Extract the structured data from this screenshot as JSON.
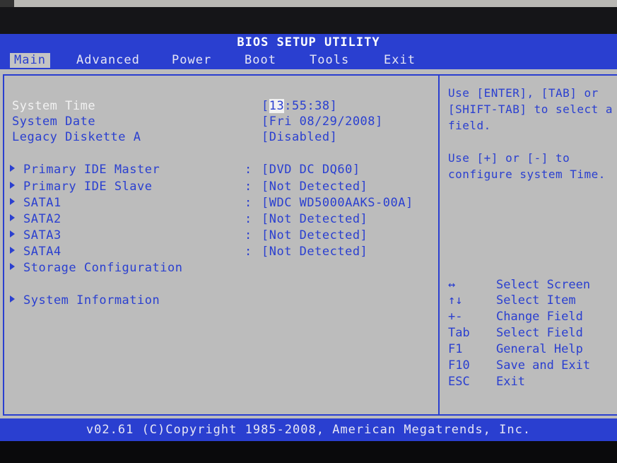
{
  "title": "BIOS SETUP UTILITY",
  "menu": [
    {
      "label": "Main",
      "active": true
    },
    {
      "label": "Advanced"
    },
    {
      "label": "Power"
    },
    {
      "label": "Boot"
    },
    {
      "label": "Tools"
    },
    {
      "label": "Exit"
    }
  ],
  "settings": {
    "system_time": {
      "label": "System Time",
      "value_prefix": "[",
      "value_cursor": "13",
      "value_rest": ":55:38]"
    },
    "system_date": {
      "label": "System Date",
      "value": "[Fri 08/29/2008]"
    },
    "legacy_diskette": {
      "label": "Legacy Diskette A",
      "value": "[Disabled]"
    }
  },
  "devices": [
    {
      "label": "Primary IDE Master",
      "value": "[DVD DC DQ60]"
    },
    {
      "label": "Primary IDE Slave",
      "value": "[Not Detected]"
    },
    {
      "label": "SATA1",
      "value": "[WDC WD5000AAKS-00A]"
    },
    {
      "label": "SATA2",
      "value": "[Not Detected]"
    },
    {
      "label": "SATA3",
      "value": "[Not Detected]"
    },
    {
      "label": "SATA4",
      "value": "[Not Detected]"
    }
  ],
  "submenus": {
    "storage": "Storage Configuration",
    "sysinfo": "System Information"
  },
  "separator": ":",
  "help": {
    "line1": "Use [ENTER], [TAB] or [SHIFT-TAB] to select a field.",
    "line2": "Use [+] or [-] to configure system Time."
  },
  "keys": [
    {
      "key": "↔",
      "desc": "Select Screen"
    },
    {
      "key": "↑↓",
      "desc": "Select Item"
    },
    {
      "key": "+-",
      "desc": "Change Field"
    },
    {
      "key": "Tab",
      "desc": "Select Field"
    },
    {
      "key": "F1",
      "desc": "General Help"
    },
    {
      "key": "F10",
      "desc": "Save and Exit"
    },
    {
      "key": "ESC",
      "desc": "Exit"
    }
  ],
  "footer": "v02.61 (C)Copyright 1985-2008, American Megatrends, Inc.",
  "colors": {
    "blue": "#2a3fd0",
    "panel": "#bcbcbc",
    "highlight": "#f2f2f2"
  }
}
